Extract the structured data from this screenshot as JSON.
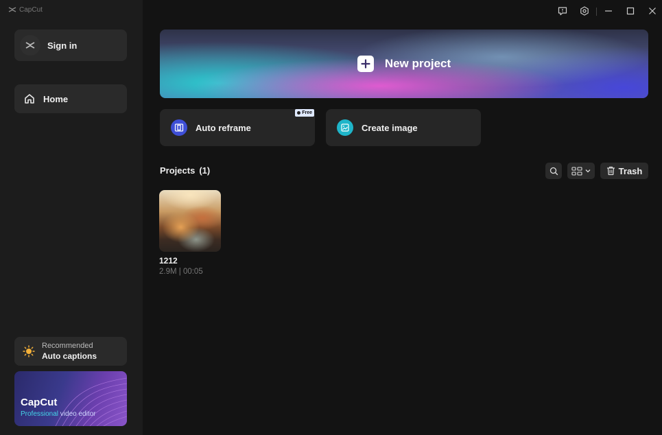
{
  "app": {
    "logo_text": "CapCut"
  },
  "sidebar": {
    "sign_in_label": "Sign in",
    "home_label": "Home",
    "recommend": {
      "title": "Recommended",
      "subtitle": "Auto captions"
    },
    "promo": {
      "title": "CapCut",
      "subtitle_highlight": "Professional",
      "subtitle_rest": " video editor"
    }
  },
  "main": {
    "new_project_label": "New project",
    "tools": [
      {
        "label": "Auto reframe",
        "badge": "Free",
        "icon": "reframe-icon",
        "color": "#3e4fd6"
      },
      {
        "label": "Create image",
        "icon": "image-icon",
        "color": "#1fb5c9"
      }
    ],
    "projects_header": {
      "title": "Projects",
      "count": "(1)"
    },
    "trash_label": "Trash",
    "projects": [
      {
        "name": "1212",
        "meta": "2.9M | 00:05"
      }
    ]
  },
  "window_controls": [
    "feedback-icon",
    "settings-icon",
    "minimize-icon",
    "maximize-icon",
    "close-icon"
  ]
}
